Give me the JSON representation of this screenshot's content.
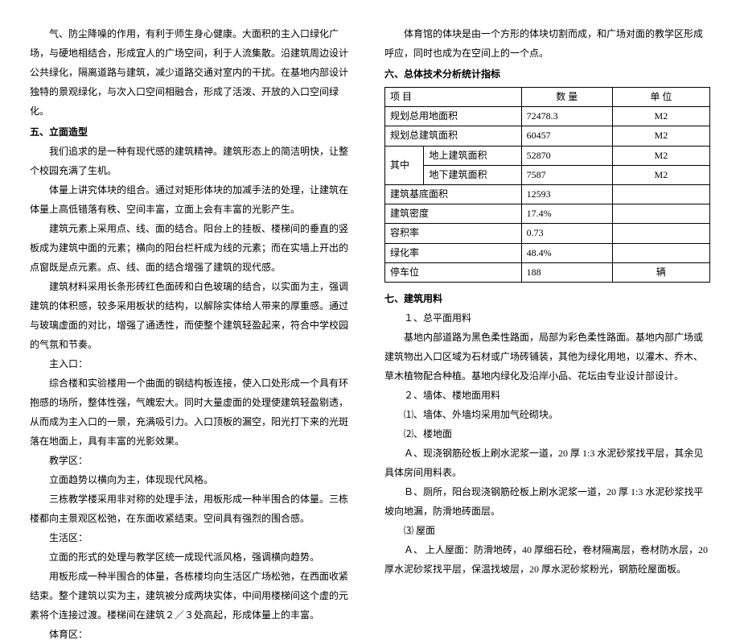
{
  "left": {
    "p1": "气、防尘降噪的作用，有利于师生身心健康。大面积的主入口绿化广场，与硬地相结合，形成宜人的广场空间，利于人流集散。沿建筑周边设计公共绿化，隔离道路与建筑，减少道路交通对室内的干扰。在基地内部设计独特的景观绿化，与次入口空间相融合，形成了活泼、开放的入口空间绿化。",
    "h5_1": "五、立面造型",
    "p2": "我们追求的是一种有现代感的建筑精神。建筑形态上的简洁明快，让整个校园充满了生机。",
    "p3": "体量上讲究体块的组合。通过对矩形体块的加减手法的处理，让建筑在体量上高低错落有秩、空间丰富，立面上会有丰富的光影产生。",
    "p4": "建筑元素上采用点、线、面的结合。阳台上的挂板、楼梯间的垂直的竖板成为建筑中面的元素；横向的阳台栏杆成为线的元素；而在实墙上开出的点窗既是点元素。点、线、面的结合增强了建筑的现代感。",
    "p5": "建筑材料采用长条形砖红色面砖和白色玻璃的结合，以实面为主，强调建筑的体积感，较多采用板状的结构，以解除实体给人带来的厚重感。通过与玻璃虚面的对比，增强了通透性，而使整个建筑轻盈起来，符合中学校园的气氛和节奏。",
    "s1_title": "主入口：",
    "s1_p": "综合楼和实验楼用一个曲面的钢结构板连接，使入口处形成一个具有环抱感的场所，整体性强，气魄宏大。同时大量虚面的处理使建筑轻盈剔透，从而成为主入口的一景，充满吸引力。入口顶板的漏空，阳光打下来的光斑落在地面上，具有丰富的光影效果。",
    "s2_title": "教学区：",
    "s2_p1": "立面趋势以横向为主，体现现代风格。",
    "s2_p2": "三栋教学楼采用非对称的处理手法，用板形成一种半围合的体量。三栋楼都向主景观区松弛，在东面收紧结束。空间具有强烈的围合感。",
    "s3_title": "生活区：",
    "s3_p1": "立面的形式的处理与教学区统一成现代派风格，强调横向趋势。",
    "s3_p2": "用板形成一种半围合的体量，各栋楼均向生活区广场松弛，在西面收紧结束。整个建筑以实为主，建筑被分成两块实体，中间用楼梯间这个虚的元素将个连接过渡。楼梯间在建筑２／３处高起，形成体量上的丰富。",
    "s4_title": "体育区："
  },
  "right": {
    "p1": "体育馆的体块是由一个方形的体块切割而成，和广场对面的教学区形成呼应，同时也成为在空间上的一个点。",
    "h6": "六、总体技术分析统计指标",
    "table": {
      "header": [
        "项     目",
        "数     量",
        "单     位"
      ],
      "rows": [
        {
          "label": "规划总用地面积",
          "sub": "",
          "qty": "72478.3",
          "unit": "M2"
        },
        {
          "label": "规划总建筑面积",
          "sub": "",
          "qty": "60457",
          "unit": "M2"
        },
        {
          "label": "其中",
          "sub": "地上建筑面积",
          "qty": "52870",
          "unit": "M2",
          "rowspan": true
        },
        {
          "label": "",
          "sub": "地下建筑面积",
          "qty": "7587",
          "unit": "M2"
        },
        {
          "label": "建筑基底面积",
          "sub": "",
          "qty": "12593",
          "unit": ""
        },
        {
          "label": "建筑密度",
          "sub": "",
          "qty": "17.4%",
          "unit": ""
        },
        {
          "label": "容积率",
          "sub": "",
          "qty": "0.73",
          "unit": ""
        },
        {
          "label": "绿化率",
          "sub": "",
          "qty": "48.4%",
          "unit": ""
        },
        {
          "label": "停车位",
          "sub": "",
          "qty": "188",
          "unit": "辆"
        }
      ]
    },
    "h7": "七、建筑用料",
    "s1_num": "１、总平面用料",
    "s1_p": "基地内部道路为黑色柔性路面，局部为彩色柔性路面。基地内部广场或建筑物出入口区域为石材或广场砖铺装，其他为绿化用地，以灌木、乔木、草木植物配合种植。基地内绿化及沿岸小品、花坛由专业设计部设计。",
    "s2_num": "２、墙体、楼地面用料",
    "s2_p1": "⑴、墙体、外墙均采用加气砼砌块。",
    "s2_p2": "⑵、楼地面",
    "s2_pA": "Ａ、现浇钢筋砼板上刷水泥浆一道，20 厚 1:3 水泥砂浆找平层，其余见具体房间用料表。",
    "s2_pB": "Ｂ、厕所，阳台现浇钢筋砼板上刷水泥浆一道，20 厚 1:3 水泥砂浆找平坡向地漏，防滑地砖面层。",
    "s3_num": "⑶  屋面",
    "s3_pA": "Ａ、 上人屋面：防滑地砖，40 厚细石砼，卷材隔离层，卷材防水层，20 厚水泥砂浆找平层，保温找坡层，20 厚水泥砂浆粉光，钢筋砼屋面板。"
  }
}
